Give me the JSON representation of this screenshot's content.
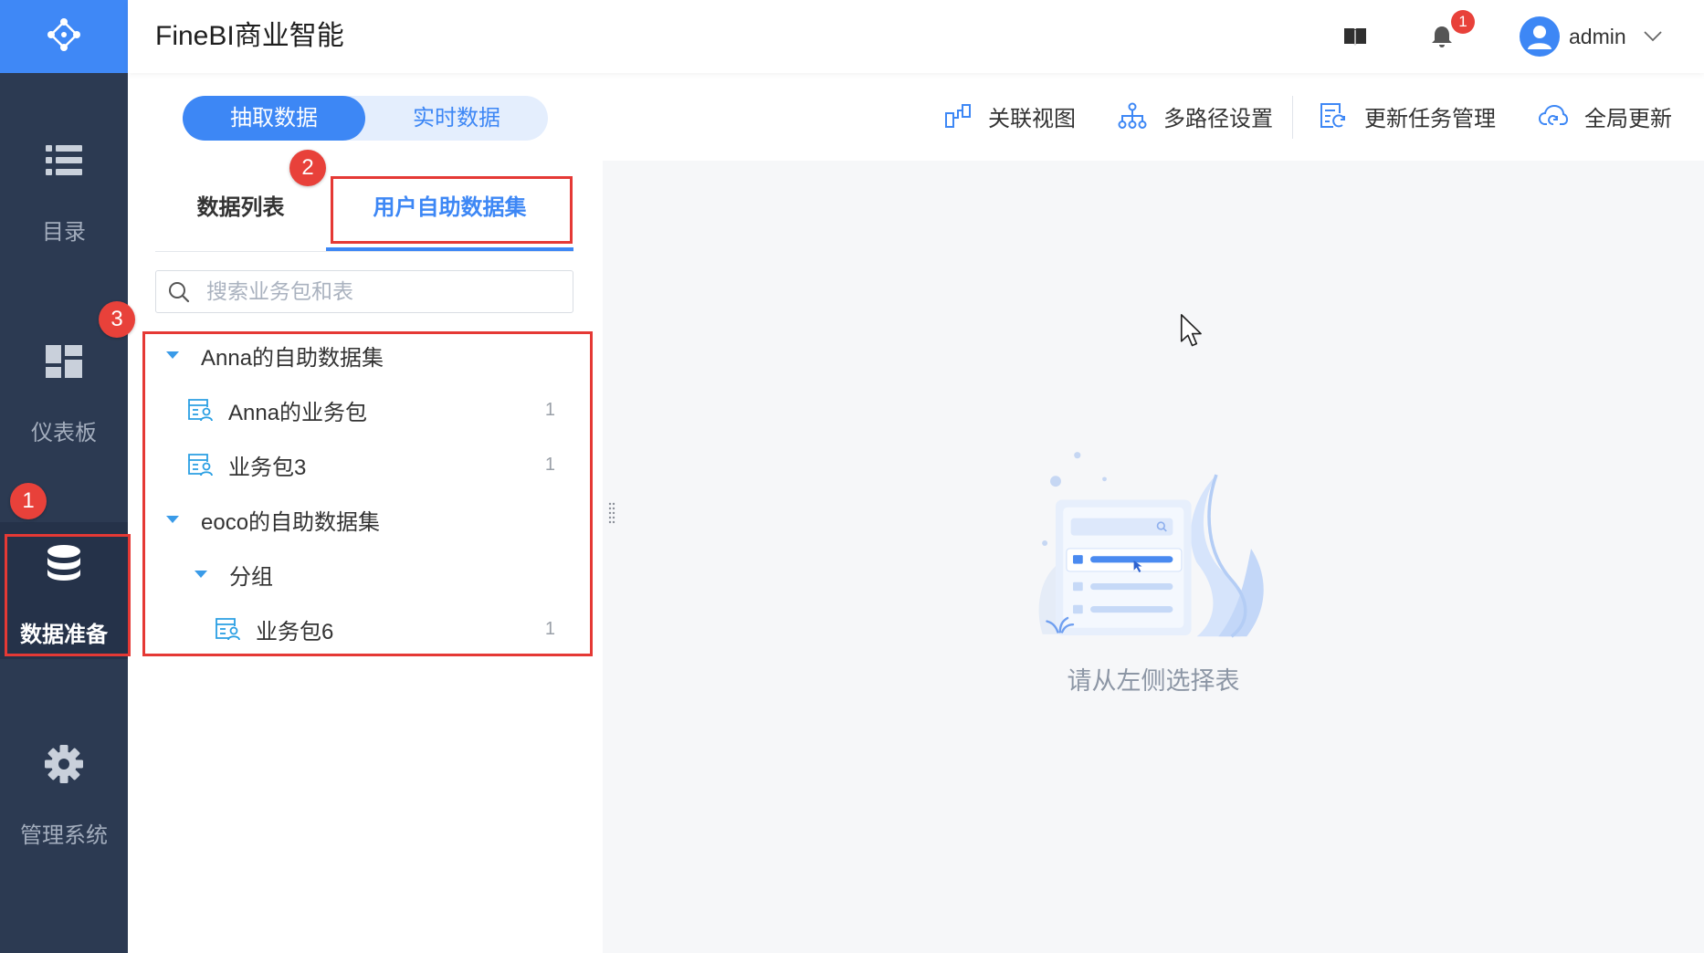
{
  "header": {
    "app_title": "FineBI商业智能",
    "notification_count": "1",
    "user_name": "admin",
    "icons": {
      "logo": "finebi-logo-icon",
      "help": "book-icon",
      "notifications": "bell-icon",
      "avatar": "user-avatar-icon",
      "menu": "chevron-down-icon"
    }
  },
  "sidebar": {
    "items": [
      {
        "label": "目录",
        "icon": "list-icon",
        "active": false
      },
      {
        "label": "仪表板",
        "icon": "dashboard-icon",
        "active": false
      },
      {
        "label": "数据准备",
        "icon": "database-icon",
        "active": true
      },
      {
        "label": "管理系统",
        "icon": "gear-icon",
        "active": false
      }
    ]
  },
  "mode_toggle": {
    "options": [
      {
        "label": "抽取数据",
        "selected": true
      },
      {
        "label": "实时数据",
        "selected": false
      }
    ]
  },
  "toolbar": {
    "items": [
      {
        "label": "关联视图",
        "icon": "relation-view-icon"
      },
      {
        "label": "多路径设置",
        "icon": "multi-path-icon"
      },
      {
        "label": "更新任务管理",
        "icon": "update-task-icon"
      },
      {
        "label": "全局更新",
        "icon": "cloud-refresh-icon"
      }
    ]
  },
  "tabs": [
    {
      "label": "数据列表",
      "active": false
    },
    {
      "label": "用户自助数据集",
      "active": true
    }
  ],
  "search": {
    "placeholder": "搜索业务包和表",
    "value": ""
  },
  "tree": [
    {
      "label": "Anna的自助数据集",
      "expanded": true,
      "children": [
        {
          "label": "Anna的业务包",
          "count": "1",
          "icon": "package-user-icon"
        },
        {
          "label": "业务包3",
          "count": "1",
          "icon": "package-user-icon"
        }
      ]
    },
    {
      "label": "eoco的自助数据集",
      "expanded": true,
      "children": [
        {
          "label": "分组",
          "expanded": true,
          "children": [
            {
              "label": "业务包6",
              "count": "1",
              "icon": "package-user-icon"
            }
          ]
        }
      ]
    }
  ],
  "empty_state": {
    "message": "请从左侧选择表",
    "icon": "empty-table-illustration"
  },
  "annotations": [
    {
      "number": "1"
    },
    {
      "number": "2"
    },
    {
      "number": "3"
    }
  ],
  "colors": {
    "accent": "#3d87f5",
    "sidebar_bg": "#2c3a52",
    "logo_bg": "#3f88f6",
    "annotation_red": "#e53935",
    "content_bg": "#f6f7f9",
    "tree_icon": "#2a9fe3"
  }
}
